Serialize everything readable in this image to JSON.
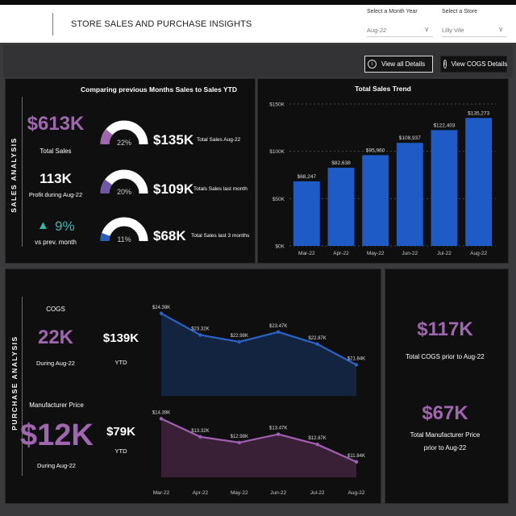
{
  "header": {
    "title": "STORE SALES AND PURCHASE INSIGHTS",
    "month_filter": {
      "label": "Select a Month Year",
      "value": "Aug-22"
    },
    "store_filter": {
      "label": "Select a Store",
      "value": "Lilly Vile"
    }
  },
  "buttons": {
    "view_all": "View all Details",
    "view_cogs": "View COGS Details"
  },
  "sales": {
    "section_label": "SALES ANALYSIS",
    "comparison_title": "Comparing previous Months Sales to Sales YTD",
    "total_sales_value": "$613K",
    "total_sales_label": "Total Sales",
    "profit_value": "113K",
    "profit_label": "Profit during Aug-22",
    "growth_value": "9%",
    "growth_label": "vs prev. month",
    "gauges": [
      {
        "percent": "22%",
        "fraction": 0.22,
        "color": "#a066b0",
        "value": "$135K",
        "label": "Total Sales Aug-22"
      },
      {
        "percent": "20%",
        "fraction": 0.2,
        "color": "#7256a6",
        "value": "$109K",
        "label": "Totals Sales last month"
      },
      {
        "percent": "11%",
        "fraction": 0.11,
        "color": "#2a5cc0",
        "value": "$68K",
        "label": "Total Sales last 3 months"
      }
    ]
  },
  "purchase": {
    "section_label": "PURCHASE ANALYSIS",
    "cogs_title": "COGS",
    "cogs_value": "22K",
    "cogs_sub": "During Aug-22",
    "cogs_ytd_value": "$139K",
    "cogs_ytd_label": "YTD",
    "mfr_title": "Manufacturer Price",
    "mfr_value": "$12K",
    "mfr_sub": "During Aug-22",
    "mfr_ytd_value": "$79K",
    "mfr_ytd_label": "YTD"
  },
  "totals": {
    "cogs_value": "$117K",
    "cogs_label": "Total COGS prior to Aug-22",
    "mfr_value": "$67K",
    "mfr_label_1": "Total Manufacturer Price",
    "mfr_label_2": "prior to Aug-22"
  },
  "chart_data": [
    {
      "type": "bar",
      "title": "Total Sales Trend",
      "categories": [
        "Mar-22",
        "Apr-22",
        "May-22",
        "Jun-22",
        "Jul-22",
        "Aug-22"
      ],
      "values": [
        68247,
        82638,
        95960,
        108937,
        122403,
        135273
      ],
      "data_labels": [
        "$68,247",
        "$82,638",
        "$95,960",
        "$108,937",
        "$122,403",
        "$135,273"
      ],
      "yticks": [
        "$0K",
        "$50K",
        "$100K",
        "$150K"
      ],
      "ylim": [
        0,
        150000
      ],
      "grid": true,
      "color": "#1e5bc6"
    },
    {
      "type": "area",
      "categories": [
        "Mar-22",
        "Apr-22",
        "May-22",
        "Jun-22",
        "Jul-22",
        "Aug-22"
      ],
      "values": [
        24390,
        23320,
        22980,
        23470,
        22870,
        21840
      ],
      "data_labels": [
        "$24.39K",
        "$23.32K",
        "$22.98K",
        "$23.47K",
        "$22.87K",
        "$21.84K"
      ],
      "ylim": [
        21500,
        24500
      ],
      "color": "#2a63c6",
      "fill": "#122440"
    },
    {
      "type": "area",
      "categories": [
        "Mar-22",
        "Apr-22",
        "May-22",
        "Jun-22",
        "Jul-22",
        "Aug-22"
      ],
      "values": [
        14390,
        13320,
        12980,
        13470,
        12870,
        11840
      ],
      "data_labels": [
        "$14.39K",
        "$13.32K",
        "$12.98K",
        "$13.47K",
        "$12.87K",
        "$11.84K"
      ],
      "ylim": [
        11500,
        14500
      ],
      "color": "#a060b0",
      "fill": "#3a2036"
    }
  ]
}
